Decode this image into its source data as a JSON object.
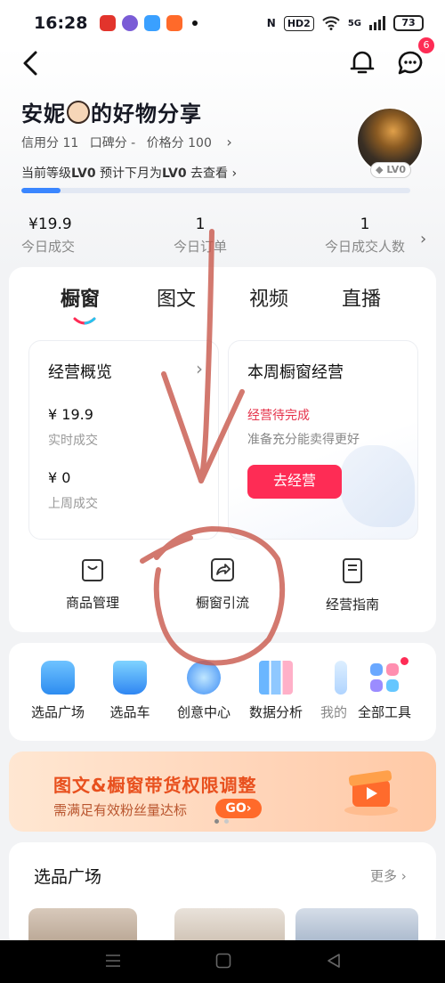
{
  "status_bar": {
    "time": "16:28",
    "network": "5G",
    "hd": "HD2",
    "nfc": "N",
    "battery": "73"
  },
  "nav": {
    "notification_badge": "6"
  },
  "profile": {
    "name_before": "安妮",
    "name_after": "的好物分享",
    "credit": "信用分 11",
    "reputation": "口碑分 -",
    "price": "价格分 100",
    "level_prefix": "当前等级",
    "level_current": "LV0",
    "level_mid": " 预计下月为",
    "level_next": "LV0",
    "level_link": " 去查看 ›",
    "level_progress": 0.1,
    "avatar_level": "LV0"
  },
  "stats": [
    {
      "value": "¥19.9",
      "label": "今日成交"
    },
    {
      "value": "1",
      "label": "今日订单"
    },
    {
      "value": "1",
      "label": "今日成交人数"
    }
  ],
  "tabs": [
    "橱窗",
    "图文",
    "视频",
    "直播"
  ],
  "overview": {
    "title": "经营概览",
    "realtime_value": "¥ 19.9",
    "realtime_label": "实时成交",
    "lastweek_value": "¥ 0",
    "lastweek_label": "上周成交"
  },
  "weekly": {
    "title": "本周橱窗经营",
    "status": "经营待完成",
    "desc": "准备充分能卖得更好",
    "button": "去经营"
  },
  "tools": [
    "商品管理",
    "橱窗引流",
    "经营指南"
  ],
  "tools2": [
    "选品广场",
    "选品车",
    "创意中心",
    "数据分析",
    "我的",
    "全部工具"
  ],
  "banner": {
    "title": "图文&橱窗带货权限调整",
    "subtitle": "需满足有效粉丝量达标",
    "go": "GO›"
  },
  "section": {
    "title": "选品广场",
    "more": "更多 ›"
  },
  "colors": {
    "accent": "#fe2c55",
    "blue": "#3a86ff"
  }
}
